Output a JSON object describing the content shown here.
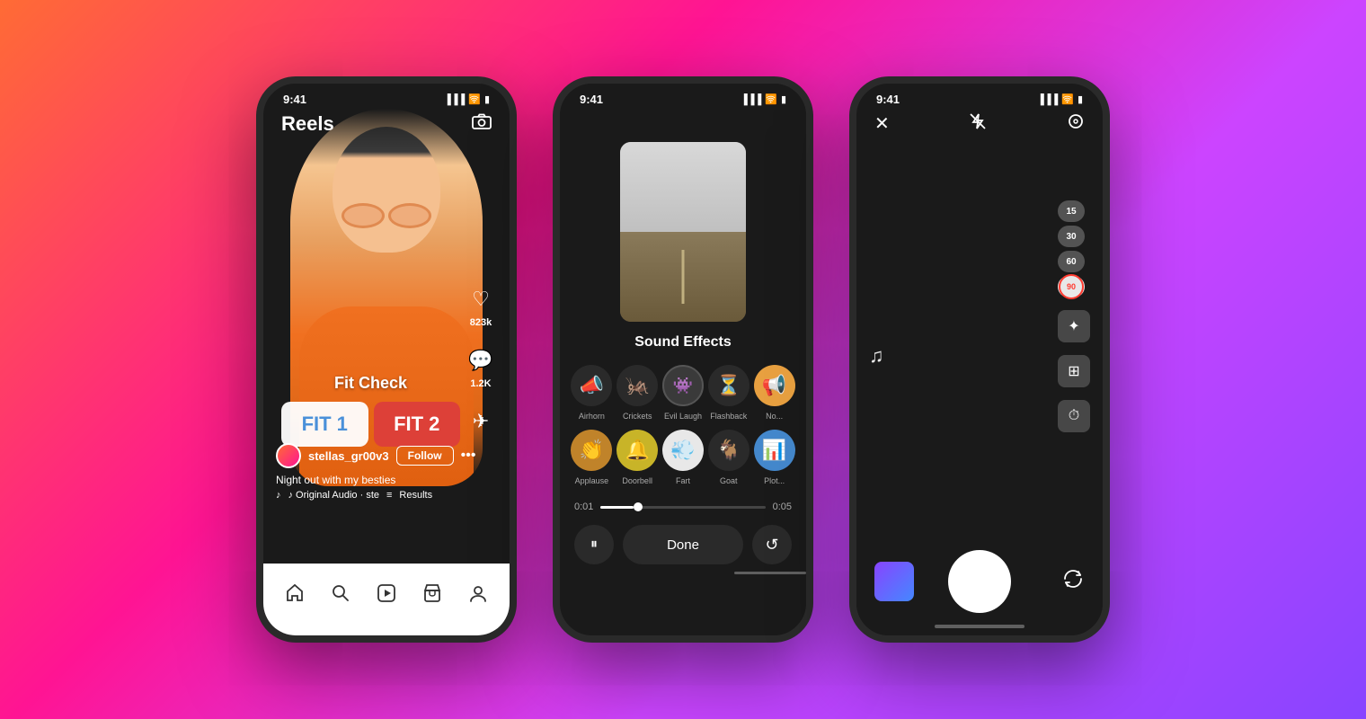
{
  "background": {
    "gradient": "linear-gradient(135deg, #ff6b35 0%, #ff1493 35%, #cc44ff 65%, #8844ff 100%)"
  },
  "phone1": {
    "status": {
      "time": "9:41",
      "signal": "●●●●",
      "wifi": "wifi",
      "battery": "battery"
    },
    "header": {
      "title": "Reels",
      "camera_label": "📷"
    },
    "poll": {
      "title": "Fit Check",
      "option1": "FIT 1",
      "option2": "FIT 2"
    },
    "user": {
      "username": "stellas_gr00v3",
      "follow_label": "Follow",
      "caption": "Night out with my besties",
      "audio": "♪ Original Audio · ste",
      "results_label": "Results"
    },
    "actions": {
      "like_count": "823k",
      "comment_count": "1.2K"
    },
    "nav": {
      "items": [
        "🏠",
        "🔍",
        "▶",
        "🛍",
        "👤"
      ]
    }
  },
  "phone2": {
    "status": {
      "time": "9:41"
    },
    "title": "Sound Effects",
    "sounds_row1": [
      {
        "emoji": "📣",
        "label": "Airhorn"
      },
      {
        "emoji": "🦗",
        "label": "Crickets"
      },
      {
        "emoji": "😈",
        "label": "Evil Laugh"
      },
      {
        "emoji": "⏳",
        "label": "Flashback"
      },
      {
        "emoji": "📢",
        "label": "No..."
      }
    ],
    "sounds_row2": [
      {
        "emoji": "👏",
        "label": "Applause"
      },
      {
        "emoji": "🔔",
        "label": "Doorbell"
      },
      {
        "emoji": "💨",
        "label": "Fart"
      },
      {
        "emoji": "🐐",
        "label": "Goat"
      },
      {
        "emoji": "📊",
        "label": "Plot..."
      }
    ],
    "progress": {
      "current": "0:01",
      "total": "0:05"
    },
    "done_label": "Done"
  },
  "phone3": {
    "status": {
      "time": "9:41"
    },
    "header": {
      "close": "✕",
      "flash_off": "⚡",
      "settings": "⚙"
    },
    "duration_btns": [
      "15",
      "30",
      "60",
      "90"
    ],
    "active_duration": "90",
    "tools": [
      "✦",
      "⊞",
      "⏱"
    ],
    "music_note": "♪"
  }
}
